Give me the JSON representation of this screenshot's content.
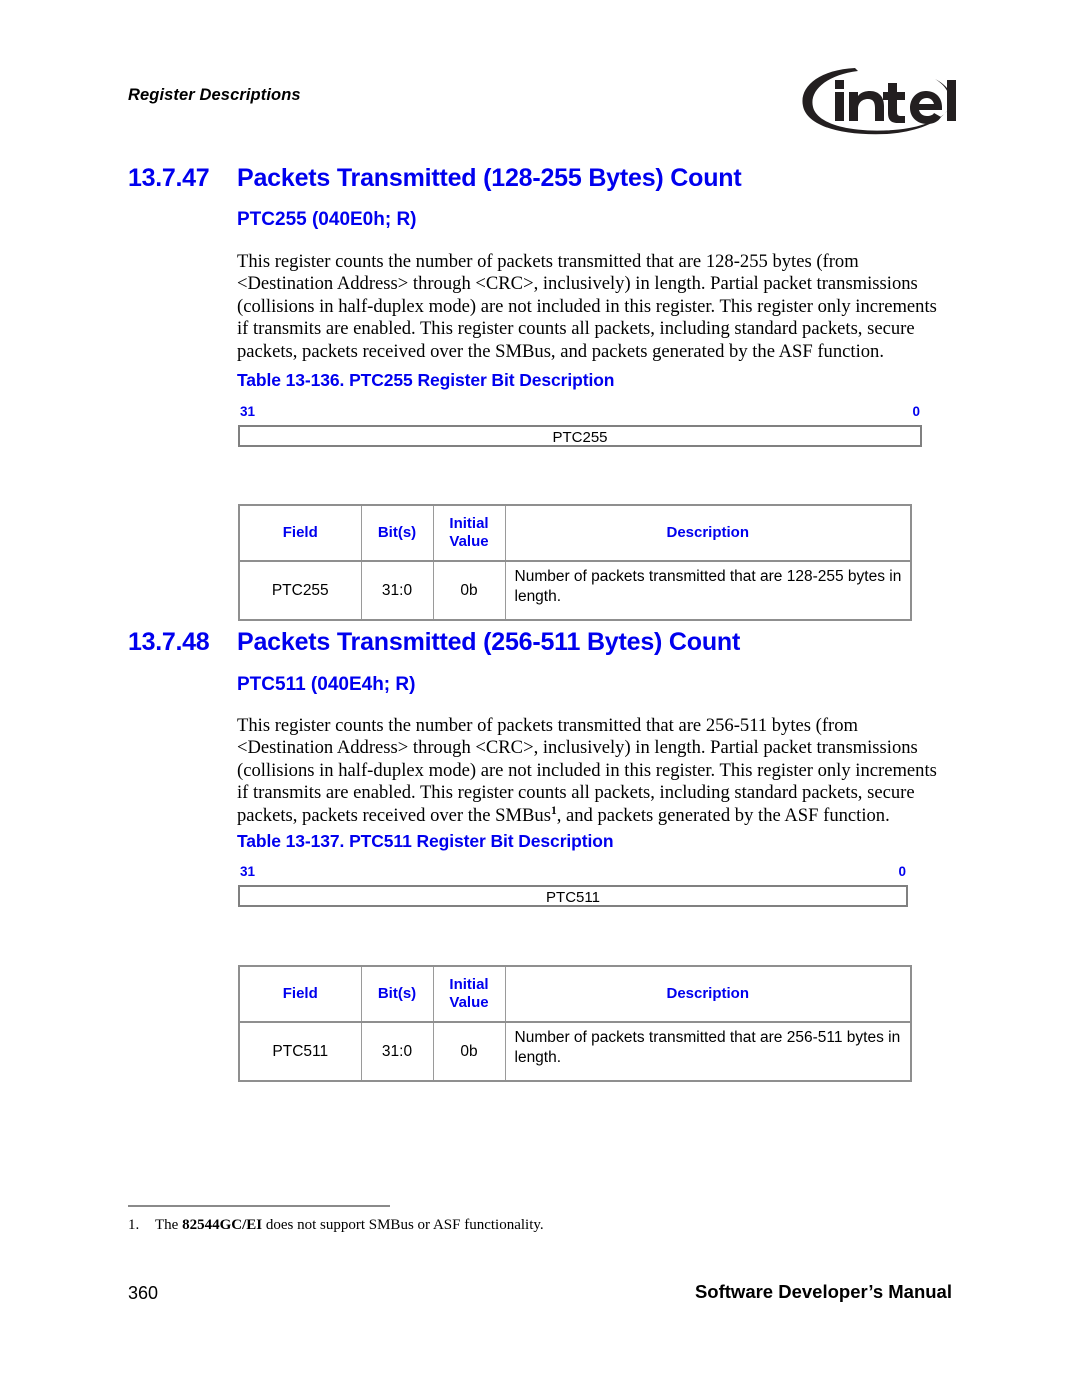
{
  "header": {
    "running_title": "Register Descriptions",
    "logo_name": "intel",
    "logo_trademark": "®"
  },
  "sections": [
    {
      "number": "13.7.47",
      "title": "Packets Transmitted (128-255 Bytes) Count",
      "subtitle": "PTC255 (040E0h; R)",
      "body": "This register counts the number of packets transmitted that are 128-255 bytes (from <Destination Address> through <CRC>, inclusively) in length. Partial packet transmissions (collisions in half-duplex mode) are not included in this register. This register only increments if transmits are enabled. This register counts all packets, including standard packets, secure packets, packets received over the SMBus, and packets generated by the ASF function.",
      "table_caption": "Table 13-136. PTC255 Register Bit Description",
      "bitfield": {
        "msb": "31",
        "lsb": "0",
        "name": "PTC255"
      },
      "table": {
        "headers": [
          "Field",
          "Bit(s)",
          "Initial Value",
          "Description"
        ],
        "rows": [
          {
            "field": "PTC255",
            "bits": "31:0",
            "initial_value": "0b",
            "description": "Number of packets transmitted that are 128-255 bytes in length."
          }
        ]
      }
    },
    {
      "number": "13.7.48",
      "title": "Packets Transmitted (256-511 Bytes) Count",
      "subtitle": "PTC511 (040E4h; R)",
      "body_before_sup": "This register counts the number of packets transmitted that are 256-511 bytes (from <Destination Address> through <CRC>, inclusively) in length. Partial packet transmissions (collisions in half-duplex mode) are not included in this register. This register only increments if transmits are enabled. This register counts all packets, including standard packets, secure packets, packets received over the SMBus",
      "body_sup": "1",
      "body_after_sup": ", and packets generated by the ASF function.",
      "table_caption": "Table 13-137. PTC511 Register Bit Description",
      "bitfield": {
        "msb": "31",
        "lsb": "0",
        "name": "PTC511"
      },
      "table": {
        "headers": [
          "Field",
          "Bit(s)",
          "Initial Value",
          "Description"
        ],
        "rows": [
          {
            "field": "PTC511",
            "bits": "31:0",
            "initial_value": "0b",
            "description": "Number of packets transmitted that are 256-511 bytes in length."
          }
        ]
      }
    }
  ],
  "footnote": {
    "number": "1.",
    "text_before_bold": "The ",
    "bold_text": "82544GC/EI",
    "text_after_bold": " does not support SMBus or ASF functionality."
  },
  "footer": {
    "page_number": "360",
    "manual_title": "Software Developer’s Manual"
  },
  "colors": {
    "heading_blue": "#0000ee",
    "border_gray": "#9a9a9a",
    "text_black": "#000000"
  }
}
